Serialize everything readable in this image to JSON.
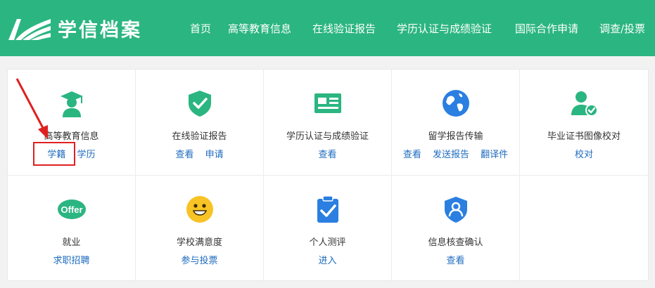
{
  "header": {
    "brand": "学信档案",
    "nav": [
      {
        "label": "首页"
      },
      {
        "label": "高等教育信息"
      },
      {
        "label": "在线验证报告"
      },
      {
        "label": "学历认证与成绩验证"
      },
      {
        "label": "国际合作申请"
      },
      {
        "label": "调查/投票"
      }
    ]
  },
  "services": [
    {
      "title": "高等教育信息",
      "icon": "graduate-icon",
      "links": [
        "学籍",
        "学历"
      ]
    },
    {
      "title": "在线验证报告",
      "icon": "shield-check-icon",
      "links": [
        "查看",
        "申请"
      ]
    },
    {
      "title": "学历认证与成绩验证",
      "icon": "id-card-icon",
      "links": [
        "查看"
      ]
    },
    {
      "title": "留学报告传输",
      "icon": "globe-icon",
      "links": [
        "查看",
        "发送报告",
        "翻译件"
      ]
    },
    {
      "title": "毕业证书图像校对",
      "icon": "user-check-icon",
      "links": [
        "校对"
      ]
    },
    {
      "title": "就业",
      "icon": "offer-icon",
      "icon_text": "Offer",
      "links": [
        "求职招聘"
      ]
    },
    {
      "title": "学校满意度",
      "icon": "smiley-icon",
      "links": [
        "参与投票"
      ]
    },
    {
      "title": "个人测评",
      "icon": "clipboard-check-icon",
      "links": [
        "进入"
      ]
    },
    {
      "title": "信息核查确认",
      "icon": "shield-user-icon",
      "links": [
        "查看"
      ]
    }
  ],
  "colors": {
    "header": "#2bb581",
    "link": "#1d6bbf",
    "annotation": "#e02020",
    "globe": "#2a7fe0",
    "smiley": "#f7c325"
  }
}
